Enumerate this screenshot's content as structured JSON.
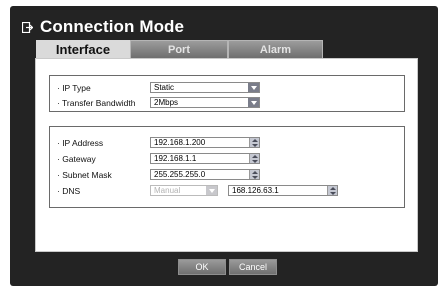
{
  "window": {
    "title": "Connection Mode"
  },
  "tabs": [
    {
      "label": "Interface"
    },
    {
      "label": "Port"
    },
    {
      "label": "Alarm"
    }
  ],
  "type_group": {
    "ip_type": {
      "label": "· IP Type",
      "value": "Static"
    },
    "transfer_bandwidth": {
      "label": "· Transfer Bandwidth",
      "value": "2Mbps"
    }
  },
  "network_group": {
    "ip_address": {
      "label": "· IP Address",
      "value": "192.168.1.200"
    },
    "gateway": {
      "label": "· Gateway",
      "value": "192.168.1.1"
    },
    "subnet_mask": {
      "label": "· Subnet Mask",
      "value": "255.255.255.0"
    },
    "dns": {
      "label": "· DNS",
      "mode": "Manual",
      "value": "168.126.63.1"
    }
  },
  "buttons": {
    "ok": "OK",
    "cancel": "Cancel"
  },
  "colors": {
    "frame_bg": "#232323",
    "active_tab": "#dadada",
    "dropdown_arrow": "#7a7d8a",
    "button_gray": "#8a8a8a"
  }
}
